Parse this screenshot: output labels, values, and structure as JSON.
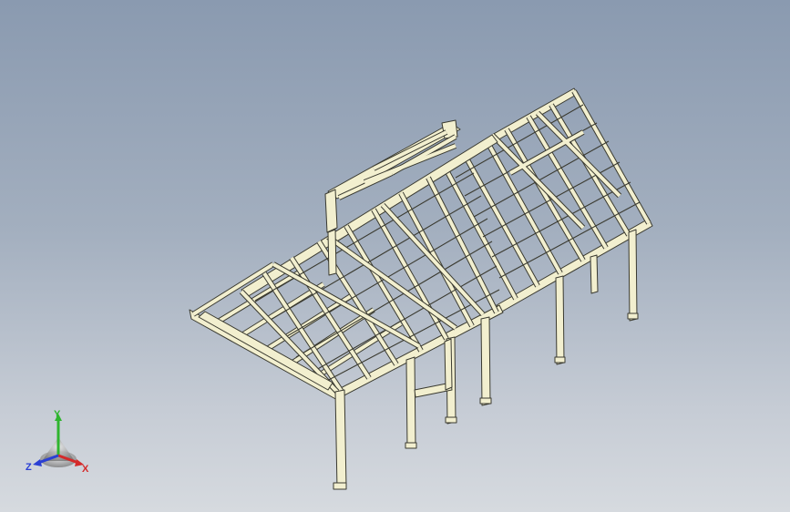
{
  "viewport": {
    "background_top": "#8a9ab0",
    "background_bottom": "#d6dadf",
    "model": {
      "type": "timber-frame-pavilion",
      "member_color": "#f2efcf",
      "edge_color": "#3a3a30"
    }
  },
  "triad": {
    "y_label": "Y",
    "x_label": "X",
    "z_label": "Z",
    "y_color": "#2fb52f",
    "x_color": "#d42a2a",
    "z_color": "#2a3fd4"
  }
}
